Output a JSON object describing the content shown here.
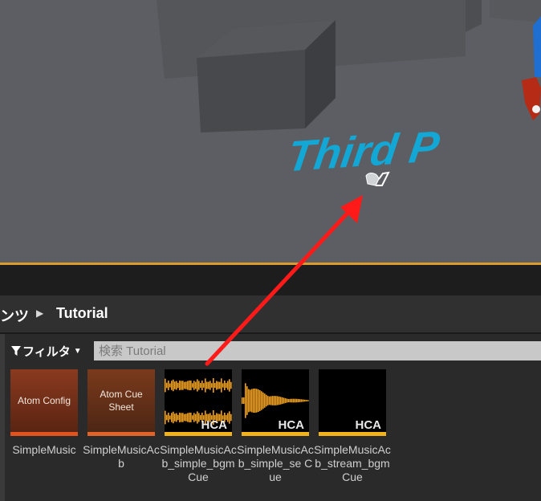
{
  "viewport": {
    "overlay_text": "Third P",
    "colors": {
      "floor": "#5c5e63",
      "text": "#12a7d4",
      "border": "#d99c2e"
    }
  },
  "content_browser": {
    "breadcrumb": {
      "previous": "ンツ",
      "separator_icon": "triangle-right-icon",
      "current": "Tutorial"
    },
    "filter": {
      "label": "フィルタ",
      "icon": "funnel-icon",
      "caret_icon": "caret-down-icon"
    },
    "search": {
      "placeholder": "検索 Tutorial",
      "value": ""
    },
    "assets": [
      {
        "thumb_text": "Atom Config",
        "name": "SimpleMusic",
        "kind": "atom-config",
        "bar_color": "#e0531f"
      },
      {
        "thumb_text": "Atom Cue Sheet",
        "name": "SimpleMusicAcb",
        "kind": "atom-cue-sheet",
        "bar_color": "#e0632a"
      },
      {
        "thumb_text": "HCA",
        "name": "SimpleMusicAcb_simple_bgm Cue",
        "kind": "cue",
        "bar_color": "#f2b21c"
      },
      {
        "thumb_text": "HCA",
        "name": "SimpleMusicAcb_simple_se Cue",
        "kind": "cue",
        "bar_color": "#f2b21c"
      },
      {
        "thumb_text": "HCA",
        "name": "SimpleMusicAcb_stream_bgm Cue",
        "kind": "cue",
        "bar_color": "#f2b21c"
      }
    ]
  },
  "annotation": {
    "arrow_color": "#ff1a1a"
  }
}
